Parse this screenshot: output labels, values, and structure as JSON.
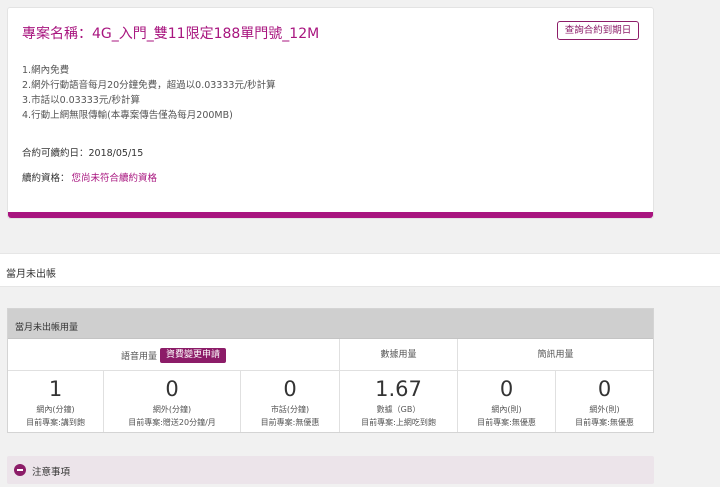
{
  "plan": {
    "title": "專案名稱：4G_入門_雙11限定188單門號_12M",
    "contract_button": "查詢合約到期日",
    "features": [
      "1.網內免費",
      "2.網外行動語音每月20分鐘免費，超過以0.03333元/秒計算",
      "3.市話以0.03333元/秒計算",
      "4.行動上網無限傳輸(本專案傳告僅為每月200MB)"
    ],
    "renew_date": "合約可續約日：2018/05/15",
    "renew_status_label": "續約資格：",
    "renew_status_value": "您尚未符合續約資格"
  },
  "section": {
    "title": "當月未出帳"
  },
  "usage": {
    "header": "當月未出帳用量",
    "categories": {
      "voice": "語音用量",
      "data": "數據用量",
      "sms": "簡訊用量"
    },
    "change_button": "資費變更申請",
    "cells": [
      {
        "value": "1",
        "label": "網內(分鐘)",
        "plan": "目前專案:講到飽"
      },
      {
        "value": "0",
        "label": "網外(分鐘)",
        "plan": "目前專案:贈送20分鐘/月"
      },
      {
        "value": "0",
        "label": "市話(分鐘)",
        "plan": "目前專案:無優惠"
      },
      {
        "value": "1.67",
        "label": "數據（GB）",
        "plan": "目前專案:上網吃到飽"
      },
      {
        "value": "0",
        "label": "網內(則)",
        "plan": "目前專案:無優惠"
      },
      {
        "value": "0",
        "label": "網外(則)",
        "plan": "目前專案:無優惠"
      }
    ]
  },
  "notice": {
    "label": "注意事項",
    "icon": "minus-circle-icon"
  },
  "colors": {
    "accent": "#a8157f",
    "button": "#8c1c68"
  }
}
